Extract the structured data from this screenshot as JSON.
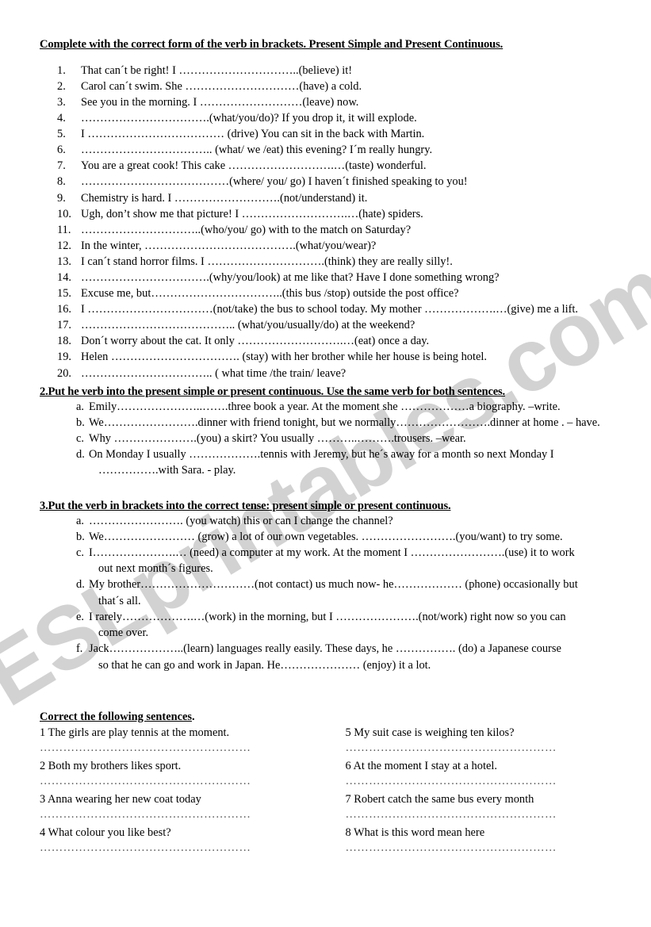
{
  "watermark": {
    "text": "ESLprintables.com"
  },
  "section1": {
    "heading": "Complete with the correct form of the verb in brackets. Present Simple and Present Continuous.",
    "items": [
      {
        "num": "1.",
        "text": "That can´t be right! I …………………………..(believe) it!"
      },
      {
        "num": "2.",
        "text": "Carol can´t swim.  She …………………………(have) a cold."
      },
      {
        "num": "3.",
        "text": "See you in the morning. I ………………………(leave) now."
      },
      {
        "num": "4.",
        "text": "…………………………….(what/you/do)? If you drop it, it will explode."
      },
      {
        "num": "5.",
        "text": "I ……………………………… (drive) You can sit in the back with Martin."
      },
      {
        "num": "6.",
        "text": "…………………………….. (what/ we /eat) this evening? I´m really hungry."
      },
      {
        "num": "7.",
        "text": "You are a great cook! This cake ……………………….…(taste) wonderful."
      },
      {
        "num": "8.",
        "text": "…………………………………(where/ you/ go) I haven´t finished speaking to you!"
      },
      {
        "num": "9.",
        "text": "Chemistry is hard. I ……………………….(not/understand) it."
      },
      {
        "num": "10.",
        "text": "Ugh, don’t show me that picture! I ……………………….…(hate) spiders."
      },
      {
        "num": "11.",
        "text": "…………………………..(who/you/ go) with to the match on Saturday?"
      },
      {
        "num": "12.",
        "text": "In the winter, ………………………………….(what/you/wear)?"
      },
      {
        "num": "13.",
        "text": "I can´t stand horror films. I ………………………….(think) they are really silly!."
      },
      {
        "num": "14.",
        "text": "…………………………….(why/you/look) at me like that? Have I done something wrong?"
      },
      {
        "num": "15.",
        "text": "Excuse me, but……………………………..(this bus /stop) outside the post office?"
      },
      {
        "num": "16.",
        "text": "I ……………………………(not/take) the bus to school today. My mother ……………….…(give) me a lift."
      },
      {
        "num": "17.",
        "text": "………………………………….. (what/you/usually/do) at the weekend?"
      },
      {
        "num": "18.",
        "text": "Don´t worry about the cat. It only ……………………….…(eat) once a day."
      },
      {
        "num": "19.",
        "text": "Helen ……………………………. (stay) with her brother while her house is being hotel."
      },
      {
        "num": "20.",
        "text": "…………………………….. ( what time /the train/ leave?"
      }
    ]
  },
  "section2": {
    "heading": "2.Put he verb into the present simple or present continuous. Use the same verb for both sentences.",
    "items": [
      {
        "num": "a.",
        "line1": "Emily…………………..…….three book a year. At the moment she ………………a biography. –write.",
        "line2": ""
      },
      {
        "num": "b.",
        "line1": "We…………………….dinner with friend tonight, but we normally…………………….dinner at home . – have.",
        "line2": ""
      },
      {
        "num": "c.",
        "line1": "Why ………………….(you) a skirt? You usually ………..……….trousers. –wear.",
        "line2": ""
      },
      {
        "num": "d.",
        "line1": "On Monday I usually ……………….tennis with Jeremy, but he´s away for a month so next Monday I",
        "line2": "…………….with Sara. - play."
      }
    ]
  },
  "section3": {
    "heading": "3.Put the verb in brackets into the correct tense: present simple or present continuous.",
    "items": [
      {
        "num": "a.",
        "line1": "……………………. (you watch) this or can I change the channel?",
        "line2": ""
      },
      {
        "num": "b.",
        "line1": "We…………………… (grow) a lot of our own vegetables. …………………….(you/want) to try some.",
        "line2": ""
      },
      {
        "num": "c.",
        "line1": "I………………….… (need) a computer at my work. At the moment I …………………….(use) it to work",
        "line2": "out next month´s figures."
      },
      {
        "num": "d.",
        "line1": "My brother…………………………(not contact) us much now- he……………… (phone) occasionally but",
        "line2": "that´s all."
      },
      {
        "num": "e.",
        "line1": "I rarely……………….…(work) in the morning, but I ………………….(not/work) right now so you can",
        "line2": "come over."
      },
      {
        "num": "f.",
        "line1": "Jack………………..(learn) languages really easily. These days, he ……………. (do) a Japanese course",
        "line2": "so that he can go and work in Japan. He………………… (enjoy) it a lot."
      }
    ]
  },
  "corrections": {
    "heading_underlined": "Correct the following sentences",
    "heading_tail": ".",
    "answer_line": "………………………………………………",
    "left": [
      "1 The girls are play tennis at the moment.",
      "2 Both my brothers likes sport.",
      "3 Anna wearing her new coat today",
      "4 What colour you like best?"
    ],
    "right": [
      "5 My suit case is weighing ten kilos?",
      "6 At the moment I stay at a hotel.",
      "7 Robert catch the same bus every month",
      "8 What is this word mean here"
    ]
  }
}
